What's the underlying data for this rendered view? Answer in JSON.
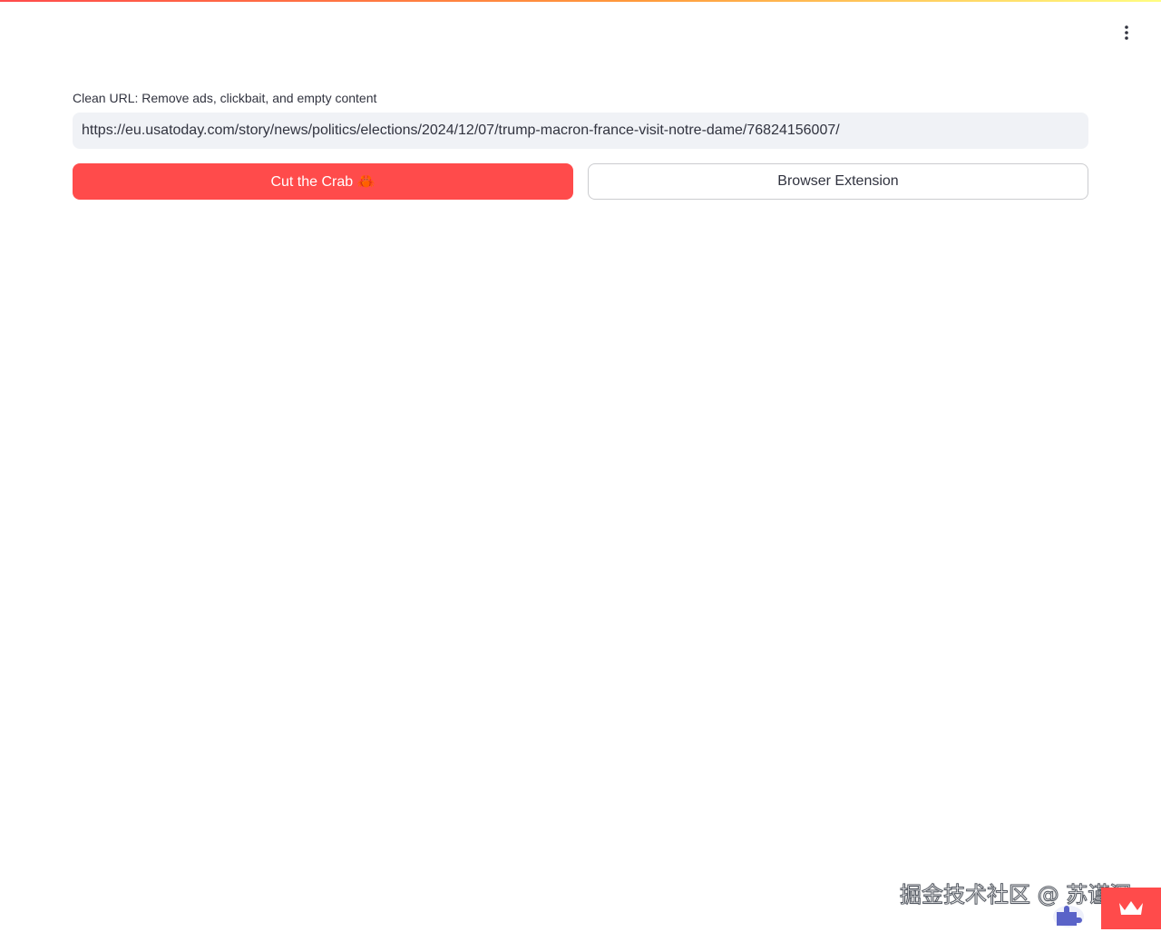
{
  "header": {
    "menu_icon": "vertical-ellipsis-icon"
  },
  "form": {
    "label": "Clean URL: Remove ads, clickbait, and empty content",
    "url_value": "https://eu.usatoday.com/story/news/politics/elections/2024/12/07/trump-macron-france-visit-notre-dame/76824156007/"
  },
  "buttons": {
    "primary_label": "Cut the Crab 🦀",
    "secondary_label": "Browser Extension"
  },
  "watermark": {
    "text": "掘金技术社区 @ 苏谨深"
  },
  "colors": {
    "primary": "#ff4b4b",
    "input_bg": "#f0f2f6",
    "text": "#31333f"
  }
}
